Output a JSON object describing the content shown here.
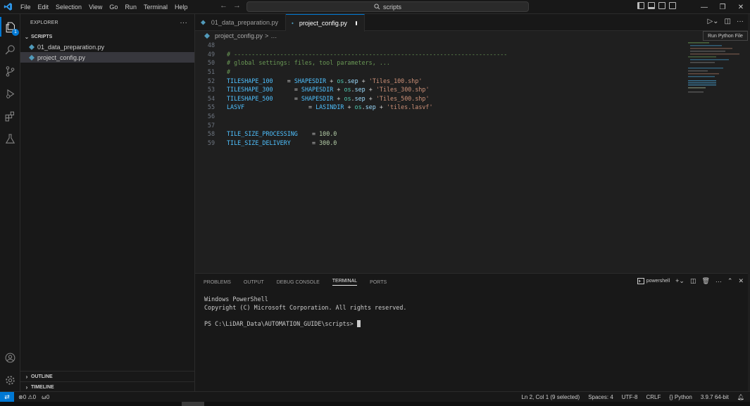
{
  "titlebar": {
    "menu": [
      "File",
      "Edit",
      "Selection",
      "View",
      "Go",
      "Run",
      "Terminal",
      "Help"
    ],
    "search_text": "scripts"
  },
  "activity": {
    "explorer_badge": "1"
  },
  "sidebar": {
    "header": "EXPLORER",
    "more": "···",
    "folder": "SCRIPTS",
    "files": [
      {
        "name": "01_data_preparation.py"
      },
      {
        "name": "project_config.py"
      }
    ],
    "outline": "OUTLINE",
    "timeline": "TIMELINE"
  },
  "editor": {
    "tabs": [
      {
        "label": "01_data_preparation.py"
      },
      {
        "label": "project_config.py"
      }
    ],
    "breadcrumb_file": "project_config.py",
    "breadcrumb_sep": ">",
    "breadcrumb_more": "…",
    "tooltip": "Run Python File",
    "lines": [
      {
        "n": "48",
        "t": []
      },
      {
        "n": "49",
        "t": [
          [
            "c-com",
            "# -----------------------------------------------------------------------------"
          ]
        ]
      },
      {
        "n": "50",
        "t": [
          [
            "c-com",
            "# global settings: files, tool parameters, ..."
          ]
        ]
      },
      {
        "n": "51",
        "t": [
          [
            "c-com",
            "#"
          ]
        ]
      },
      {
        "n": "52",
        "t": [
          [
            "c-var",
            "TILESHAPE_100"
          ],
          [
            "",
            "    = "
          ],
          [
            "c-var",
            "SHAPESDIR"
          ],
          [
            "",
            " + "
          ],
          [
            "c-obj",
            "os"
          ],
          [
            "",
            "."
          ],
          [
            "c-prop",
            "sep"
          ],
          [
            "",
            " + "
          ],
          [
            "c-str",
            "'Tiles_100.shp'"
          ]
        ]
      },
      {
        "n": "53",
        "t": [
          [
            "c-var",
            "TILESHAPE_300"
          ],
          [
            "",
            "      = "
          ],
          [
            "c-var",
            "SHAPESDIR"
          ],
          [
            "",
            " + "
          ],
          [
            "c-obj",
            "os"
          ],
          [
            "",
            "."
          ],
          [
            "c-prop",
            "sep"
          ],
          [
            "",
            " + "
          ],
          [
            "c-str",
            "'Tiles_300.shp'"
          ]
        ]
      },
      {
        "n": "54",
        "t": [
          [
            "c-var",
            "TILESHAPE_500"
          ],
          [
            "",
            "      = "
          ],
          [
            "c-var",
            "SHAPESDIR"
          ],
          [
            "",
            " + "
          ],
          [
            "c-obj",
            "os"
          ],
          [
            "",
            "."
          ],
          [
            "c-prop",
            "sep"
          ],
          [
            "",
            " + "
          ],
          [
            "c-str",
            "'Tiles_500.shp'"
          ]
        ]
      },
      {
        "n": "55",
        "t": [
          [
            "c-var",
            "LASVF"
          ],
          [
            "",
            "                  = "
          ],
          [
            "c-var",
            "LASINDIR"
          ],
          [
            "",
            " + "
          ],
          [
            "c-obj",
            "os"
          ],
          [
            "",
            "."
          ],
          [
            "c-prop",
            "sep"
          ],
          [
            "",
            " + "
          ],
          [
            "c-str",
            "'tiles.lasvf'"
          ]
        ]
      },
      {
        "n": "56",
        "t": []
      },
      {
        "n": "57",
        "t": []
      },
      {
        "n": "58",
        "t": [
          [
            "c-var",
            "TILE_SIZE_PROCESSING"
          ],
          [
            "",
            "    = "
          ],
          [
            "c-num",
            "100.0"
          ]
        ]
      },
      {
        "n": "59",
        "t": [
          [
            "c-var",
            "TILE_SIZE_DELIVERY"
          ],
          [
            "",
            "      = "
          ],
          [
            "c-num",
            "300.0"
          ]
        ]
      }
    ]
  },
  "panel": {
    "tabs": [
      "PROBLEMS",
      "OUTPUT",
      "DEBUG CONSOLE",
      "TERMINAL",
      "PORTS"
    ],
    "active_tab": "TERMINAL",
    "shell": "powershell",
    "terminal_lines": [
      "Windows PowerShell",
      "Copyright (C) Microsoft Corporation. All rights reserved.",
      "",
      "PS C:\\LiDAR_Data\\AUTOMATION_GUIDE\\scripts> "
    ]
  },
  "statusbar": {
    "errors": "0",
    "warnings": "0",
    "ports": "0",
    "position": "Ln 2, Col 1 (9 selected)",
    "spaces": "Spaces: 4",
    "encoding": "UTF-8",
    "eol": "CRLF",
    "language": "Python",
    "interpreter": "3.9.7 64-bit"
  },
  "colors": {
    "accent": "#0078d4",
    "comment": "#6a9955",
    "variable": "#4fc1ff",
    "string": "#ce9178",
    "number": "#b5cea8",
    "python_icon": "#519aba"
  }
}
